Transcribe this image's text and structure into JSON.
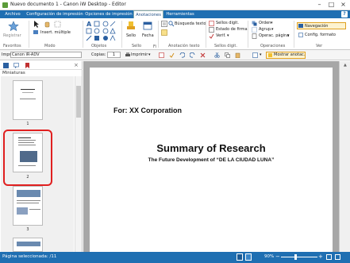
{
  "window": {
    "title": "Nuevo documento 1 - Canon iW Desktop - Editor"
  },
  "menu": {
    "tabs": [
      "Archivo",
      "Configuración de impresión",
      "Opciones de impresión",
      "Anotaciones",
      "Herramientas"
    ],
    "active": "Anotaciones",
    "help": "?"
  },
  "ribbon": {
    "favoritos": {
      "label": "Favoritos",
      "registrar": "Registrar"
    },
    "modo": {
      "label": "Modo",
      "insert": "Insert. múltiple"
    },
    "objetos": {
      "label": "Objetos"
    },
    "sello": {
      "label": "Sello",
      "sello_btn": "Sello",
      "fecha_btn": "Fecha",
      "fi": "Fi"
    },
    "anotacion_texto": {
      "label": "Anotación texto",
      "busqueda": "Búsqueda texto"
    },
    "sellos_digit": {
      "label": "Sellos digit.",
      "sellos": "Sellos digit.",
      "estado": "Estado de firma",
      "verif": "Verif."
    },
    "operaciones": {
      "label": "Operaciones",
      "orden": "Orden",
      "agrup": "Agrup.",
      "operac": "Operac. página"
    },
    "ver": {
      "label": "Ver",
      "navegacion": "Navegación",
      "config": "Config. formato"
    }
  },
  "toolbar": {
    "printer_label": "Impr:",
    "printer_value": "Canon iR-ADV",
    "copies_label": "Copias:",
    "copies_value": "1",
    "print_btn": "Imprimir",
    "show_annot": "Mostrar anotac."
  },
  "left_panel": {
    "title": "Miniaturas",
    "pages": [
      "1",
      "2",
      "3"
    ]
  },
  "document": {
    "for_line": "For: XX Corporation",
    "heading": "Summary of Research",
    "subheading": "The Future Development of “DE LA CIUDAD LUNA”"
  },
  "status": {
    "pages_selected": "Página seleccionada: /11",
    "zoom": "90%"
  },
  "colors": {
    "accent": "#1f6fb2",
    "selection": "#e02020"
  }
}
